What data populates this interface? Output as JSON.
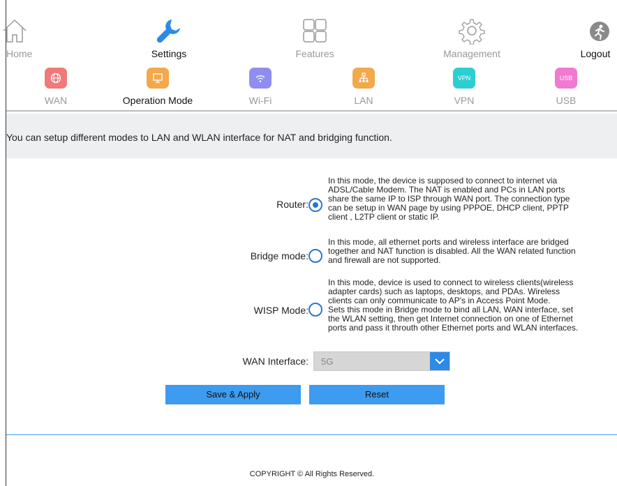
{
  "top_nav": [
    {
      "label": "Home",
      "icon": "home-icon",
      "active": false
    },
    {
      "label": "Settings",
      "icon": "wrench-icon",
      "active": true
    },
    {
      "label": "Features",
      "icon": "grid-icon",
      "active": false
    },
    {
      "label": "Management",
      "icon": "gear-icon",
      "active": false
    },
    {
      "label": "Logout",
      "icon": "logout-icon",
      "active": false
    }
  ],
  "sub_nav": [
    {
      "label": "WAN",
      "badge": "",
      "color": "#ef7a7a",
      "active": false
    },
    {
      "label": "Operation Mode",
      "badge": "",
      "color": "#f2a94b",
      "active": true
    },
    {
      "label": "Wi-Fi",
      "badge": "",
      "color": "#8f8df0",
      "active": false
    },
    {
      "label": "LAN",
      "badge": "",
      "color": "#f2a94b",
      "active": false
    },
    {
      "label": "VPN",
      "badge": "VPN",
      "color": "#2ccfd1",
      "active": false
    },
    {
      "label": "USB",
      "badge": "USB",
      "color": "#f07ad0",
      "active": false
    }
  ],
  "info_text": "You can setup different modes to LAN and WLAN interface for NAT and bridging function.",
  "modes": [
    {
      "label": "Router:",
      "checked": true,
      "lines": [
        "In this mode, the device is supposed to connect to internet via",
        "ADSL/Cable Modem. The NAT is enabled and PCs in LAN ports",
        "share the same IP to ISP through WAN port. The connection type",
        "can be setup in WAN page by using PPPOE, DHCP client, PPTP",
        "client , L2TP client or static IP."
      ]
    },
    {
      "label": "Bridge mode:",
      "checked": false,
      "lines": [
        "In this mode, all ethernet ports and wireless interface are bridged",
        "together and NAT function is disabled. All the WAN related function",
        "and firewall are not supported."
      ]
    },
    {
      "label": "WISP Mode:",
      "checked": false,
      "lines": [
        "In this mode, device is used to connect to wireless clients(wireless",
        "adapter cards) such as laptops, desktops, and PDAs. Wireless",
        "clients can only communicate to AP's in Access Point Mode.",
        "Sets this mode in Bridge mode to bind all LAN, WAN interface, set",
        "the WLAN setting, then get Internet connection on one of Ethernet",
        "ports and pass it throuth other Ethernet ports and WLAN interfaces."
      ]
    }
  ],
  "wan_interface": {
    "label": "WAN Interface:",
    "value": "5G"
  },
  "buttons": {
    "save": "Save & Apply",
    "reset": "Reset"
  },
  "copyright": "COPYRIGHT © All Rights Reserved."
}
